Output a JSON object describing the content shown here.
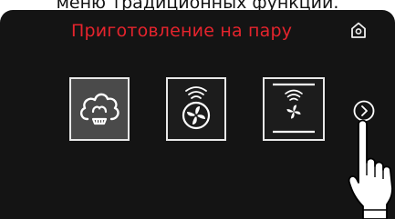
{
  "caption": "меню традиционных функций.",
  "screen": {
    "title": "Приготовление на пару",
    "title_color": "#e5242d",
    "background": "#141414"
  },
  "icons": {
    "home": "home-icon",
    "next": "chevron-right-icon",
    "pointer": "pointing-hand-icon"
  },
  "modes": [
    {
      "icon": "steam-icon",
      "selected": true
    },
    {
      "icon": "steam-fan-icon",
      "selected": false
    },
    {
      "icon": "steam-fan-top-bottom-heat-icon",
      "selected": false
    }
  ]
}
